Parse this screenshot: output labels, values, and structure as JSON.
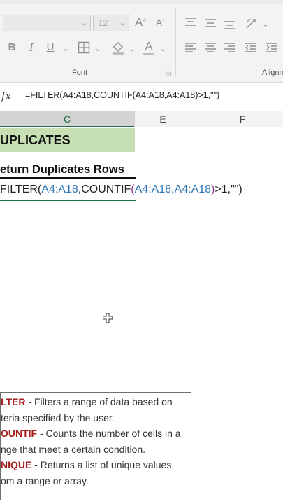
{
  "ribbon": {
    "font_size_value": "12",
    "font_group_label": "Font",
    "alignment_group_label": "Alignm",
    "buttons": {
      "grow_font": "A",
      "shrink_font": "A",
      "bold": "B",
      "italic": "I",
      "underline": "U",
      "font_color": "A"
    }
  },
  "formula_bar": {
    "fx_label": "fx",
    "formula": "=FILTER(A4:A18,COUNTIF(A4:A18,A4:A18)>1,\"\")"
  },
  "columns": [
    "C",
    "E",
    "F"
  ],
  "sheet": {
    "title": "UPLICATES",
    "subtitle": "eturn Duplicates Rows",
    "cell_formula_parts": [
      {
        "text": "FILTER(",
        "kind": "plain"
      },
      {
        "text": "A4:A18",
        "kind": "ref"
      },
      {
        "text": ",COUNTIF",
        "kind": "plain"
      },
      {
        "text": "(",
        "kind": "paren"
      },
      {
        "text": "A4:A18",
        "kind": "ref"
      },
      {
        "text": ",",
        "kind": "plain"
      },
      {
        "text": "A4:A18",
        "kind": "ref"
      },
      {
        "text": ")",
        "kind": "paren"
      },
      {
        "text": ">1,\"\")",
        "kind": "plain"
      }
    ]
  },
  "textbox": {
    "lines": [
      {
        "keyword": "LTER",
        "text": " - Filters a range of data based on"
      },
      {
        "keyword": "",
        "text": "teria specified by the user."
      },
      {
        "keyword": "OUNTIF",
        "text": " - Counts the number of cells in a"
      },
      {
        "keyword": "",
        "text": "nge that meet a certain condition."
      },
      {
        "keyword": "NIQUE",
        "text": " - Returns a list of unique values"
      },
      {
        "keyword": "",
        "text": "om a range or array."
      }
    ]
  },
  "colors": {
    "title_fill": "#c6e0b4",
    "keyword": "#a51e1e",
    "reference": "#2e75b6",
    "active_column": "#1e7145"
  }
}
